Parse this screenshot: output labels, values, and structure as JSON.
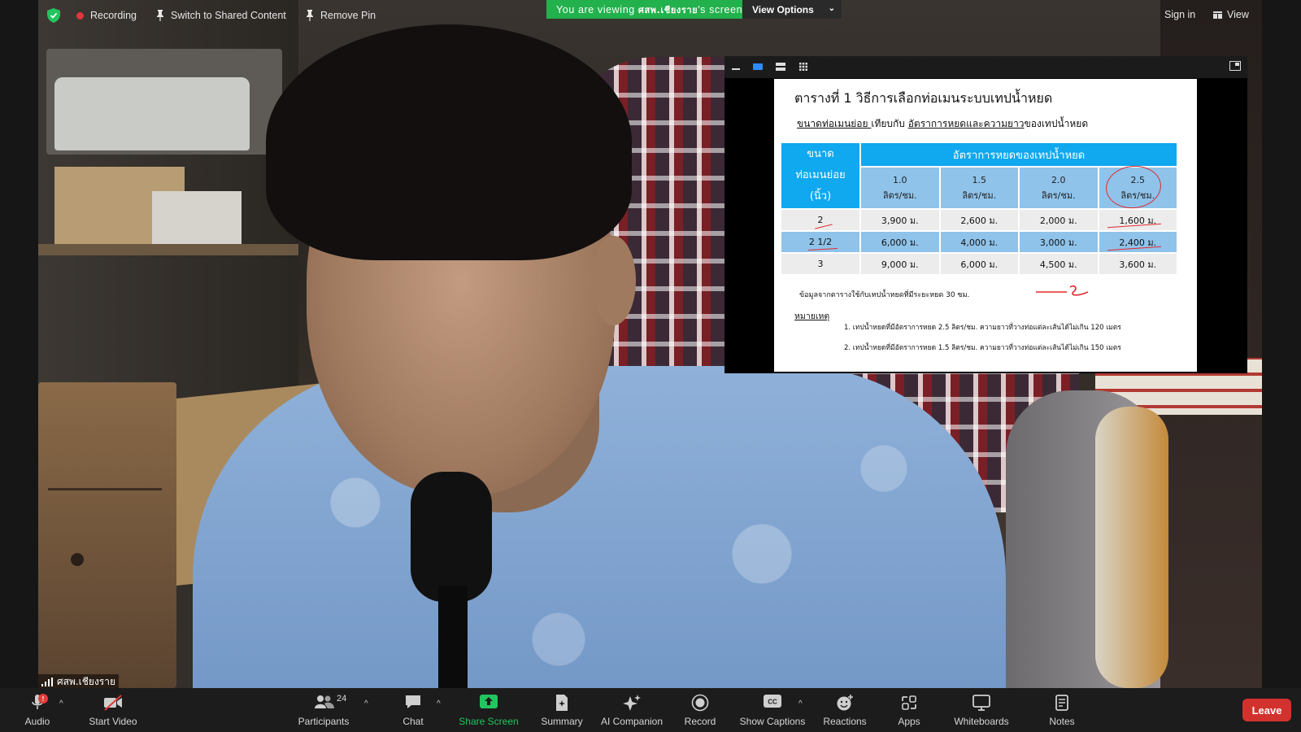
{
  "topbar": {
    "recording_label": "Recording",
    "switch_label": "Switch to Shared Content",
    "remove_pin_label": "Remove Pin",
    "viewing_prefix": "You are viewing ",
    "viewing_name": "ศสพ.เชียงราย",
    "viewing_suffix": "'s screen",
    "view_options_label": "View Options",
    "sign_in_label": "Sign in",
    "view_label": "View"
  },
  "shared_document": {
    "title": "ตารางที่ 1 วิธีการเลือกท่อเมนระบบเทปน้ำหยด",
    "subtitle_part1": "ขนาดท่อเมนย่อย ",
    "subtitle_part2": "เทียบกับ ",
    "subtitle_part3": "อัตราการหยดและความยาว",
    "subtitle_part4": "ของเทปน้ำหยด",
    "size_header": [
      "ขนาด",
      "ท่อเมนย่อย",
      "(นิ้ว)"
    ],
    "rate_header": "อัตราการหยดของเทปน้ำหยด",
    "rate_columns": [
      {
        "rate": "1.0",
        "unit": "ลิตร/ชม."
      },
      {
        "rate": "1.5",
        "unit": "ลิตร/ชม."
      },
      {
        "rate": "2.0",
        "unit": "ลิตร/ชม."
      },
      {
        "rate": "2.5",
        "unit": "ลิตร/ชม."
      }
    ],
    "rows": [
      {
        "size": "2",
        "values": [
          "3,900 ม.",
          "2,600 ม.",
          "2,000 ม.",
          "1,600 ม."
        ]
      },
      {
        "size": "2 1/2",
        "values": [
          "6,000 ม.",
          "4,000 ม.",
          "3,000 ม.",
          "2,400 ม."
        ]
      },
      {
        "size": "3",
        "values": [
          "9,000 ม.",
          "6,000 ม.",
          "4,500 ม.",
          "3,600 ม."
        ]
      }
    ],
    "note": "ข้อมูลจากตารางใช้กับเทปน้ำหยดที่มีระยะหยด 30 ซม.",
    "remark_label": "หมายเหตุ",
    "remarks": [
      "1. เทปน้ำหยดที่มีอัตราการหยด 2.5 ลิตร/ชม. ความยาวที่วางท่อแต่ละเส้นได้ไม่เกิน 120 เมตร",
      "2. เทปน้ำหยดที่มีอัตราการหยด 1.5 ลิตร/ชม. ความยาวที่วางท่อแต่ละเส้นได้ไม่เกิน 150 เมตร"
    ]
  },
  "participant_name": "ศสพ.เชียงราย",
  "toolbar": {
    "audio_label": "Audio",
    "audio_badge": "!",
    "start_video_label": "Start Video",
    "participants_label": "Participants",
    "participants_count": "24",
    "chat_label": "Chat",
    "share_screen_label": "Share Screen",
    "summary_label": "Summary",
    "ai_companion_label": "AI Companion",
    "record_label": "Record",
    "show_captions_label": "Show Captions",
    "reactions_label": "Reactions",
    "apps_label": "Apps",
    "whiteboards_label": "Whiteboards",
    "notes_label": "Notes",
    "leave_label": "Leave"
  },
  "colors": {
    "viewing_banner": "#22b14c",
    "share_screen_accent": "#22c55e",
    "leave_button": "#d2322d",
    "table_header": "#10a8ef",
    "table_blue_row": "#8fc3ea",
    "pen_ink": "#e2282d"
  }
}
